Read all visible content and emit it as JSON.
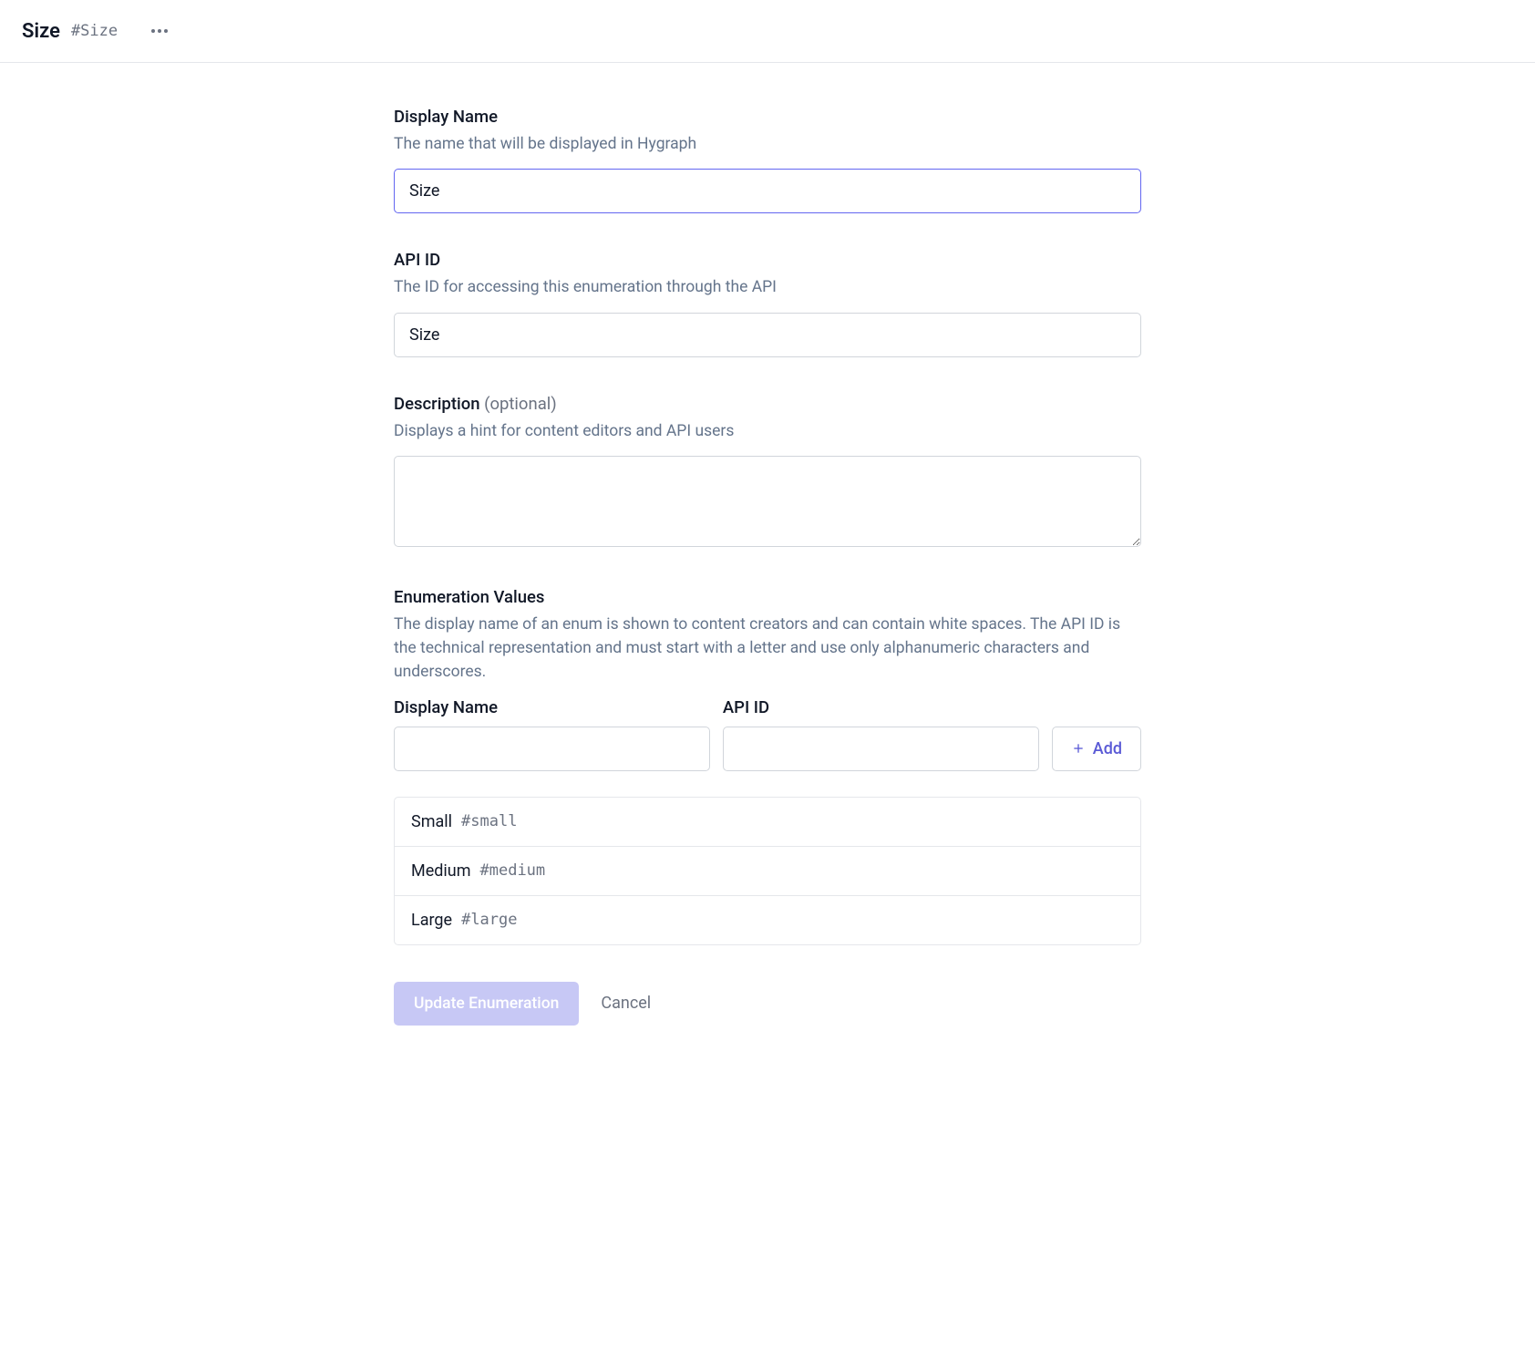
{
  "header": {
    "title": "Size",
    "hash": "#Size"
  },
  "fields": {
    "displayName": {
      "label": "Display Name",
      "helper": "The name that will be displayed in Hygraph",
      "value": "Size"
    },
    "apiId": {
      "label": "API ID",
      "helper": "The ID for accessing this enumeration through the API",
      "value": "Size"
    },
    "description": {
      "label": "Description",
      "optional": "(optional)",
      "helper": "Displays a hint for content editors and API users",
      "value": ""
    },
    "enumValues": {
      "label": "Enumeration Values",
      "helper": "The display name of an enum is shown to content creators and can contain white spaces. The API ID is the technical representation and must start with a letter and use only alphanumeric characters and underscores.",
      "colDisplayName": "Display Name",
      "colApiId": "API ID",
      "addLabel": "Add",
      "items": [
        {
          "display": "Small",
          "api": "#small"
        },
        {
          "display": "Medium",
          "api": "#medium"
        },
        {
          "display": "Large",
          "api": "#large"
        }
      ]
    }
  },
  "actions": {
    "submit": "Update Enumeration",
    "cancel": "Cancel"
  }
}
